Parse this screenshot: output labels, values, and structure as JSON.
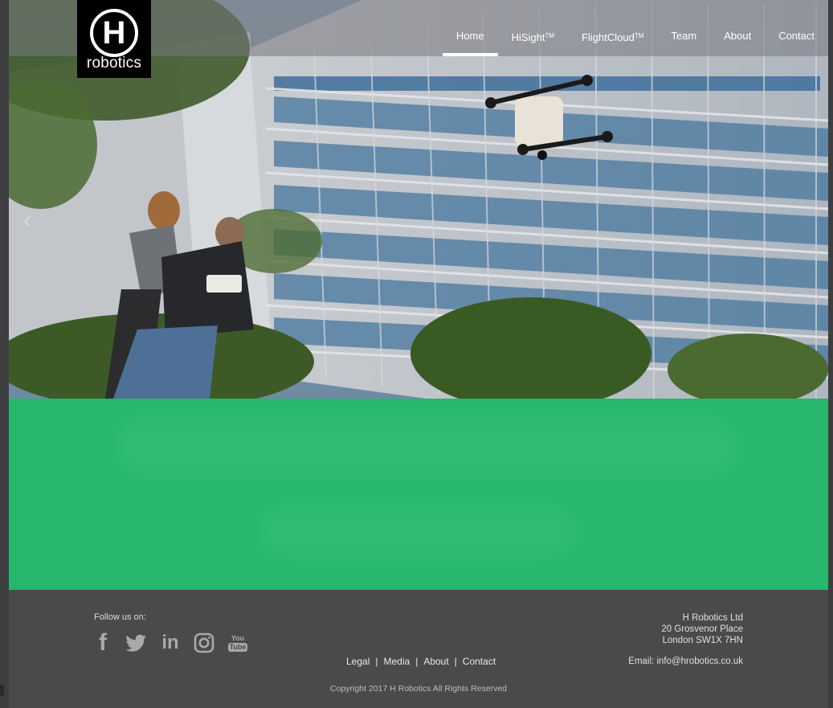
{
  "brand": {
    "logo_letter": "H",
    "logo_word": "robotics"
  },
  "nav": {
    "items": [
      {
        "label": "Home",
        "tm": ""
      },
      {
        "label": "HiSight",
        "tm": "TM"
      },
      {
        "label": "FlightCloud",
        "tm": "TM"
      },
      {
        "label": "Team",
        "tm": ""
      },
      {
        "label": "About",
        "tm": ""
      },
      {
        "label": "Contact",
        "tm": ""
      }
    ],
    "active": "Home"
  },
  "hero": {
    "prev_arrow_icon": "chevron-left-icon",
    "prev_arrow_glyph": "‹"
  },
  "footer": {
    "follow_label": "Follow us on:",
    "social": [
      {
        "name": "facebook-icon",
        "glyph": "f"
      },
      {
        "name": "twitter-icon",
        "glyph": "🐦"
      },
      {
        "name": "linkedin-icon",
        "glyph": "in"
      },
      {
        "name": "instagram-icon",
        "glyph": "◎"
      },
      {
        "name": "youtube-icon",
        "glyph": "You Tube"
      }
    ],
    "links": [
      "Legal",
      "Media",
      "About",
      "Contact"
    ],
    "link_separator": "|",
    "company": "H Robotics Ltd",
    "address_line1": "20 Grosvenor Place",
    "address_line2": "London SW1X 7HN",
    "email_label": "Email: ",
    "email": "info@hrobotics.co.uk",
    "copyright": "Copyright 2017 H Robotics All Rights Reserved"
  },
  "colors": {
    "accent_green": "#26b76c",
    "footer_bg": "#4a4a4c",
    "logo_bg": "#000000"
  }
}
